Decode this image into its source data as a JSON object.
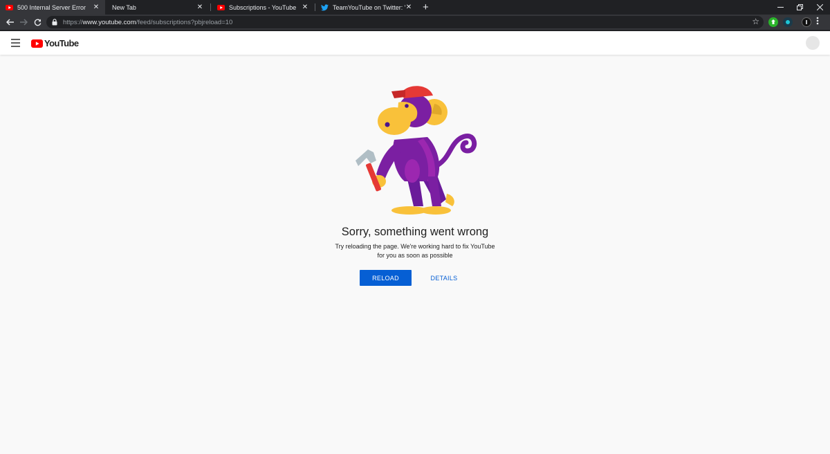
{
  "browser": {
    "tabs": [
      {
        "title": "500 Internal Server Error",
        "icon": "youtube-icon",
        "active": true
      },
      {
        "title": "New Tab",
        "icon": "",
        "active": false
      },
      {
        "title": "Subscriptions - YouTube",
        "icon": "youtube-icon",
        "active": false
      },
      {
        "title": "TeamYouTube on Twitter: \"That's",
        "icon": "twitter-icon",
        "active": false
      }
    ],
    "close_glyph": "✕",
    "new_tab_glyph": "+",
    "url_scheme": "https://",
    "url_host": "www.youtube.com",
    "url_path": "/feed/subscriptions?pbjreload=10"
  },
  "header": {
    "logo_text": "YouTube",
    "brand_color": "#ff0000"
  },
  "error": {
    "title": "Sorry, something went wrong",
    "description_line1": "Try reloading the page. We're working hard to fix YouTube",
    "description_line2": "for you as soon as possible",
    "reload_label": "RELOAD",
    "details_label": "DETAILS",
    "accent_color": "#065fd4"
  }
}
